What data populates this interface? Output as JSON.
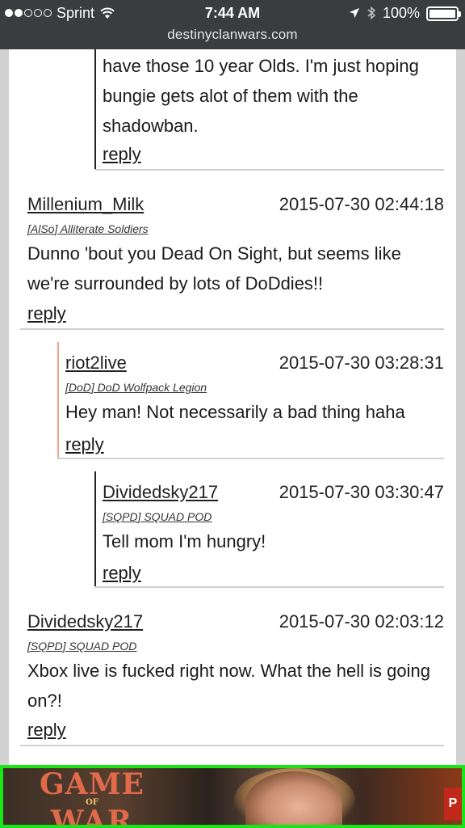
{
  "status_bar": {
    "carrier": "Sprint",
    "time": "7:44 AM",
    "battery": "100%"
  },
  "url_bar": {
    "url": "destinyclanwars.com"
  },
  "comments": [
    {
      "text": "have those 10 year Olds. I'm just hoping bungie gets alot of them with the shadowban.",
      "reply": "reply"
    },
    {
      "author": "Millenium_Milk",
      "date": "2015-07-30 02:44:18",
      "clan": "[AlSo] Alliterate Soldiers",
      "text": "Dunno 'bout you Dead On Sight, but seems like we're surrounded by lots of DoDdies!!",
      "reply": "reply"
    },
    {
      "author": "riot2live",
      "date": "2015-07-30 03:28:31",
      "clan": "[DoD] DoD Wolfpack Legion",
      "text": "Hey man! Not necessarily a bad thing haha",
      "reply": "reply"
    },
    {
      "author": "Dividedsky217",
      "date": "2015-07-30 03:30:47",
      "clan": "[SQPD] SQUAD POD",
      "text": "Tell mom I'm hungry!",
      "reply": "reply"
    },
    {
      "author": "Dividedsky217",
      "date": "2015-07-30 02:03:12",
      "clan": "[SQPD] SQUAD POD",
      "text": "Xbox live is fucked right now. What the hell is going on?!",
      "reply": "reply"
    }
  ],
  "ad": {
    "logo_top": "GAME",
    "logo_mid": "OF",
    "logo_bottom": "WAR",
    "badge": "P",
    "accent_color": "#19e619"
  },
  "colors": {
    "chrome": "#3b3c3e",
    "page": "#ffffff",
    "reply_line_orange": "#f0a582"
  }
}
